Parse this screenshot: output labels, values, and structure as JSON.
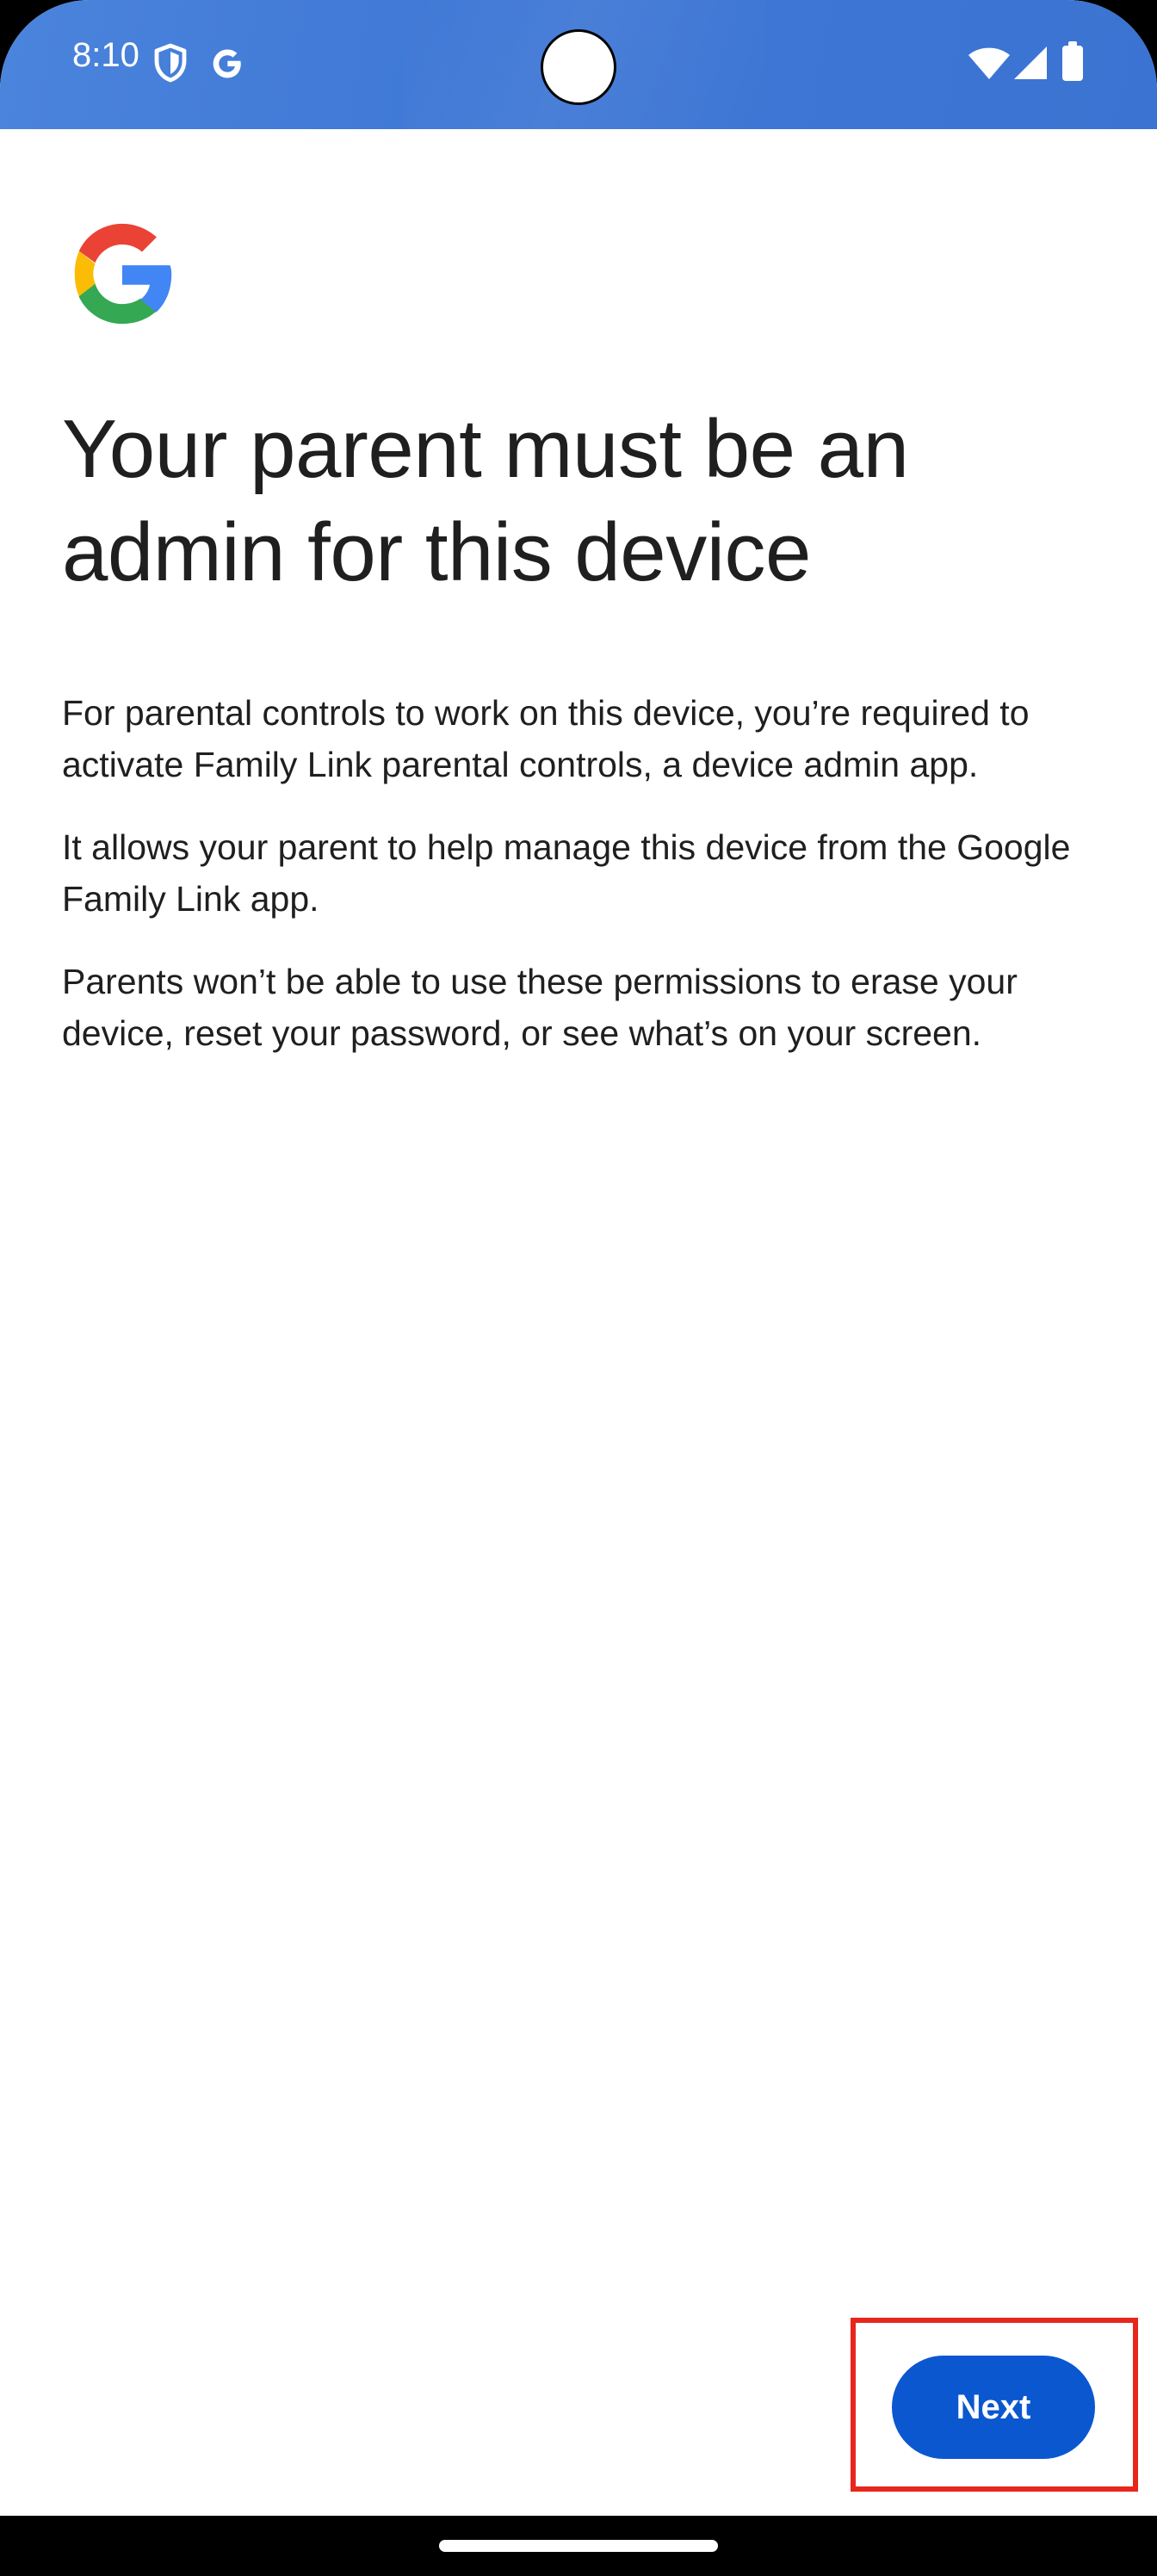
{
  "status_bar": {
    "time": "8:10",
    "left_icons": [
      "shield-icon",
      "google-g-icon"
    ],
    "right_icons": [
      "wifi-icon",
      "cellular-signal-icon",
      "battery-icon"
    ],
    "background_color": "#3f78d6"
  },
  "setup_screen": {
    "logo": "Google",
    "title": "Your parent must be an admin for this device",
    "paragraphs": [
      "For parental controls to work on this device, you’re required to activate Family Link parental controls, a device admin app.",
      "It allows your parent to help manage this device from the Google Family Link app.",
      "Parents won’t be able to use these permissions to erase your device, reset your password, or see what’s on your screen."
    ],
    "next_button_label": "Next",
    "accent_color": "#0b57d0",
    "highlight_color": "#e8261c"
  },
  "navigation": {
    "gesture_handle": "home-indicator"
  }
}
